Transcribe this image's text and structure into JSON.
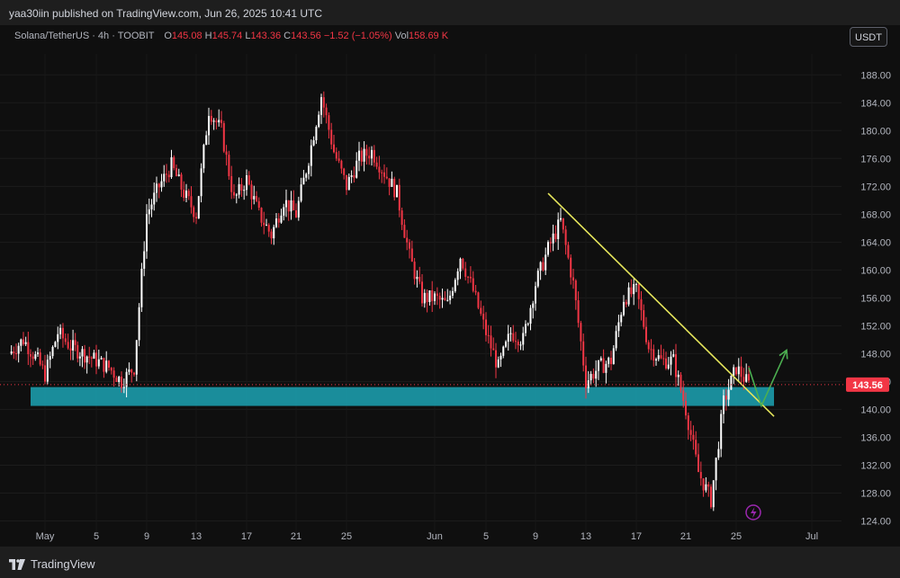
{
  "header": {
    "published_text": "yaa30iin published on TradingView.com, Jun 26, 2025 10:41 UTC"
  },
  "legend": {
    "symbol": "Solana/TetherUS · 4h · TOOBIT",
    "open_label": "O",
    "open": "145.08",
    "high_label": "H",
    "high": "145.74",
    "low_label": "L",
    "low": "143.36",
    "close_label": "C",
    "close": "143.56",
    "change": "−1.52 (−1.05%)",
    "vol_label": "Vol",
    "vol": "158.69 K"
  },
  "currency_button": "USDT",
  "footer": {
    "brand": "TradingView"
  },
  "colors": {
    "up": "#ffffff",
    "down": "#f23645",
    "zone": "#1ca3b4",
    "trendline": "#e6e65c",
    "arrow": "#4caf50",
    "price_tag": "#f23645",
    "lightning": "#9c27b0"
  },
  "chart_data": {
    "type": "candlestick",
    "title": "",
    "xlabel": "",
    "ylabel": "",
    "ylim": [
      122,
      191
    ],
    "y_ticks": [
      "188.00",
      "184.00",
      "180.00",
      "176.00",
      "172.00",
      "168.00",
      "164.00",
      "160.00",
      "156.00",
      "152.00",
      "148.00",
      "144.00",
      "140.00",
      "136.00",
      "132.00",
      "128.00",
      "124.00"
    ],
    "x_ticks": [
      "May",
      "5",
      "9",
      "13",
      "17",
      "21",
      "25",
      "Jun",
      "5",
      "9",
      "13",
      "17",
      "21",
      "25",
      "Jul"
    ],
    "current_price": "143.56",
    "price_path": [
      {
        "date": "Apr 26",
        "price": 148
      },
      {
        "date": "Apr 28",
        "price": 150
      },
      {
        "date": "Apr 30",
        "price": 147
      },
      {
        "date": "May 1",
        "price": 145
      },
      {
        "date": "May 2",
        "price": 151
      },
      {
        "date": "May 3",
        "price": 149
      },
      {
        "date": "May 5",
        "price": 147
      },
      {
        "date": "May 6",
        "price": 146
      },
      {
        "date": "May 7",
        "price": 144
      },
      {
        "date": "May 8",
        "price": 146
      },
      {
        "date": "May 9",
        "price": 168
      },
      {
        "date": "May 10",
        "price": 172
      },
      {
        "date": "May 11",
        "price": 175
      },
      {
        "date": "May 12",
        "price": 171
      },
      {
        "date": "May 13",
        "price": 168
      },
      {
        "date": "May 14",
        "price": 183
      },
      {
        "date": "May 15",
        "price": 180
      },
      {
        "date": "May 16",
        "price": 170
      },
      {
        "date": "May 17",
        "price": 173
      },
      {
        "date": "May 18",
        "price": 168
      },
      {
        "date": "May 19",
        "price": 165
      },
      {
        "date": "May 20",
        "price": 170
      },
      {
        "date": "May 21",
        "price": 168
      },
      {
        "date": "May 22",
        "price": 176
      },
      {
        "date": "May 23",
        "price": 185
      },
      {
        "date": "May 24",
        "price": 177
      },
      {
        "date": "May 25",
        "price": 172
      },
      {
        "date": "May 26",
        "price": 176
      },
      {
        "date": "May 27",
        "price": 177
      },
      {
        "date": "May 28",
        "price": 174
      },
      {
        "date": "May 29",
        "price": 171
      },
      {
        "date": "May 30",
        "price": 162
      },
      {
        "date": "May 31",
        "price": 156
      },
      {
        "date": "Jun 1",
        "price": 156
      },
      {
        "date": "Jun 2",
        "price": 155
      },
      {
        "date": "Jun 3",
        "price": 162
      },
      {
        "date": "Jun 4",
        "price": 157
      },
      {
        "date": "Jun 5",
        "price": 151
      },
      {
        "date": "Jun 6",
        "price": 146
      },
      {
        "date": "Jun 7",
        "price": 151
      },
      {
        "date": "Jun 8",
        "price": 150
      },
      {
        "date": "Jun 9",
        "price": 158
      },
      {
        "date": "Jun 10",
        "price": 163
      },
      {
        "date": "Jun 11",
        "price": 167
      },
      {
        "date": "Jun 12",
        "price": 158
      },
      {
        "date": "Jun 13",
        "price": 144
      },
      {
        "date": "Jun 14",
        "price": 146
      },
      {
        "date": "Jun 15",
        "price": 147
      },
      {
        "date": "Jun 16",
        "price": 156
      },
      {
        "date": "Jun 17",
        "price": 157
      },
      {
        "date": "Jun 18",
        "price": 149
      },
      {
        "date": "Jun 19",
        "price": 147
      },
      {
        "date": "Jun 20",
        "price": 147
      },
      {
        "date": "Jun 21",
        "price": 140
      },
      {
        "date": "Jun 22",
        "price": 131
      },
      {
        "date": "Jun 23",
        "price": 127
      },
      {
        "date": "Jun 24",
        "price": 141
      },
      {
        "date": "Jun 25",
        "price": 146
      },
      {
        "date": "Jun 26",
        "price": 143.56
      }
    ],
    "annotations": {
      "support_zone": {
        "from_date": "Apr 29",
        "to_date": "Jun 28",
        "low": 140.5,
        "high": 143.2
      },
      "downtrend_line": {
        "start": {
          "date": "Jun 10",
          "price": 171
        },
        "end": {
          "date": "Jun 28",
          "price": 139
        }
      },
      "projection_arrow": [
        {
          "date": "Jun 26",
          "price": 146
        },
        {
          "date": "Jun 27",
          "price": 140.5
        },
        {
          "date": "Jun 29",
          "price": 148.5
        }
      ]
    }
  }
}
